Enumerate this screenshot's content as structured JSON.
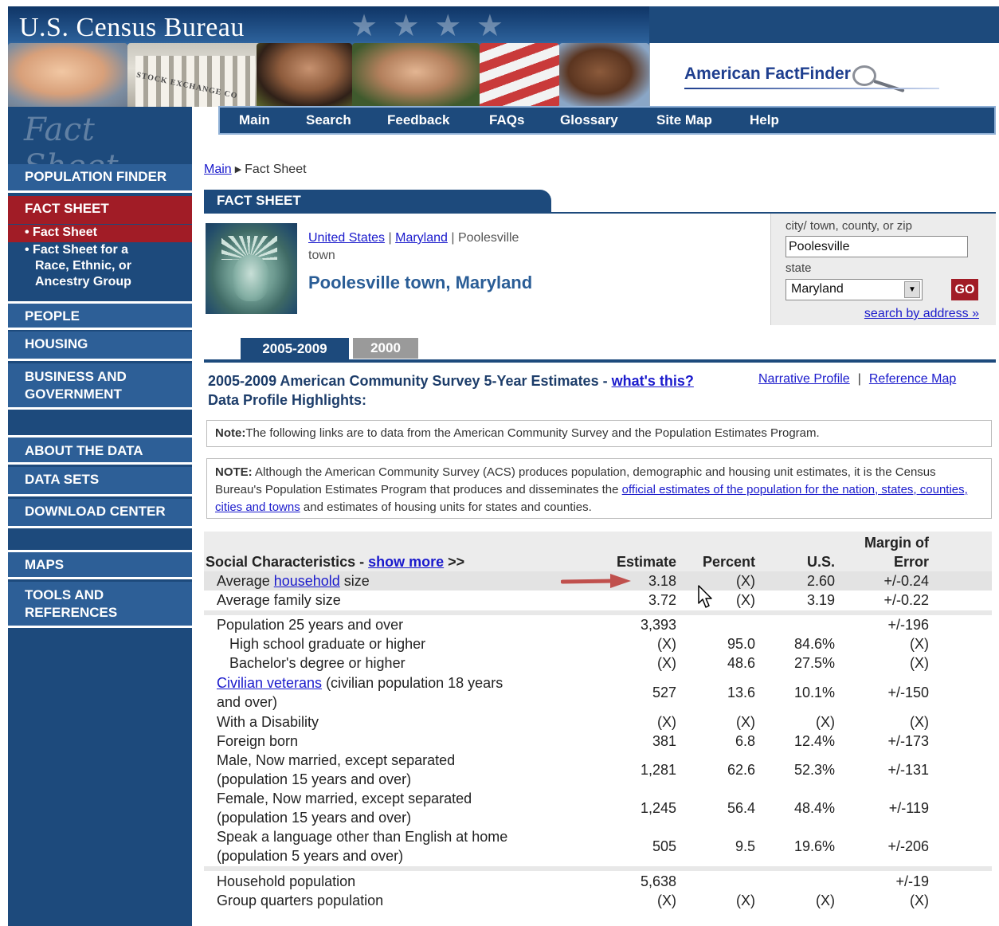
{
  "header": {
    "bureau_title": "U.S. Census Bureau",
    "stock_exchange_text": "STOCK EXCHANGE CO",
    "factfinder_logo": "American FactFinder",
    "fact_sheet_script": "Fact Sheet"
  },
  "nav": {
    "items": [
      "Main",
      "Search",
      "Feedback",
      "FAQs",
      "Glossary",
      "Site Map",
      "Help"
    ]
  },
  "sidebar": {
    "population_finder": "POPULATION FINDER",
    "fact_sheet": "FACT SHEET",
    "sub_fact_sheet": "• Fact Sheet",
    "sub_race_1": "• Fact Sheet for a",
    "sub_race_2": "Race, Ethnic, or",
    "sub_race_3": "Ancestry Group",
    "people": "PEOPLE",
    "housing": "HOUSING",
    "business_1": "BUSINESS AND",
    "business_2": "GOVERNMENT",
    "about": "ABOUT THE DATA",
    "data_sets": "DATA SETS",
    "download": "DOWNLOAD CENTER",
    "maps": "MAPS",
    "tools_1": "TOOLS AND",
    "tools_2": "REFERENCES"
  },
  "breadcrumb": {
    "main": "Main",
    "current": "Fact Sheet"
  },
  "fact_sheet_header": "FACT SHEET",
  "geo": {
    "us_link": "United States",
    "state_link": "Maryland",
    "sep": " | ",
    "place_line1": "Poolesville",
    "place_line2": "town",
    "title": "Poolesville town, Maryland"
  },
  "search": {
    "city_label": "city/ town, county, or zip",
    "city_value": "Poolesville",
    "state_label": "state",
    "state_value": "Maryland",
    "go_label": "GO",
    "address_link": "search by address »"
  },
  "year_tabs": {
    "active": "2005-2009",
    "inactive": "2000"
  },
  "survey": {
    "heading": "2005-2009 American Community Survey 5-Year Estimates - ",
    "whats_this": "what's this?",
    "subheading": "Data Profile Highlights:",
    "narrative_link": "Narrative Profile",
    "link_sep": "|",
    "reference_link": "Reference Map"
  },
  "notes": {
    "note1_bold": "Note:",
    "note1_text": "The following links are to data from the American Community Survey and the Population Estimates Program.",
    "note2_bold": "NOTE:",
    "note2_text_a": " Although the American Community Survey (ACS) produces population, demographic and housing unit estimates, it is the Census Bureau's Population Estimates Program that produces and disseminates the ",
    "note2_link": "official estimates of the population for the nation, states, counties, cities and towns",
    "note2_text_b": " and estimates of housing units for states and counties."
  },
  "table": {
    "section_title": "Social Characteristics - ",
    "show_more": "show more",
    "show_more_suffix": " >>",
    "headers": {
      "estimate": "Estimate",
      "percent": "Percent",
      "us": "U.S.",
      "moe_1": "Margin of",
      "moe_2": "Error"
    },
    "rows": [
      {
        "label_a": "Average ",
        "label_link": "household",
        "label_b": " size",
        "estimate": "3.18",
        "percent": "(X)",
        "us": "2.60",
        "moe": "+/-0.24"
      },
      {
        "label": "Average family size",
        "estimate": "3.72",
        "percent": "(X)",
        "us": "3.19",
        "moe": "+/-0.22"
      },
      {
        "label": "Population 25 years and over",
        "estimate": "3,393",
        "percent": "",
        "us": "",
        "moe": "+/-196"
      },
      {
        "label": "High school graduate or higher",
        "estimate": "(X)",
        "percent": "95.0",
        "us": "84.6%",
        "moe": "(X)"
      },
      {
        "label": "Bachelor's degree or higher",
        "estimate": "(X)",
        "percent": "48.6",
        "us": "27.5%",
        "moe": "(X)"
      },
      {
        "label_link": "Civilian veterans",
        "label_b": " (civilian population 18 years",
        "label_c": "and over)",
        "estimate": "527",
        "percent": "13.6",
        "us": "10.1%",
        "moe": "+/-150"
      },
      {
        "label": "With a Disability",
        "estimate": "(X)",
        "percent": "(X)",
        "us": "(X)",
        "moe": "(X)"
      },
      {
        "label": "Foreign born",
        "estimate": "381",
        "percent": "6.8",
        "us": "12.4%",
        "moe": "+/-173"
      },
      {
        "label": "Male, Now married, except separated",
        "label_c": "(population 15 years and over)",
        "estimate": "1,281",
        "percent": "62.6",
        "us": "52.3%",
        "moe": "+/-131"
      },
      {
        "label": "Female, Now married, except separated",
        "label_c": "(population 15 years and over)",
        "estimate": "1,245",
        "percent": "56.4",
        "us": "48.4%",
        "moe": "+/-119"
      },
      {
        "label": "Speak a language other than English at home",
        "label_c": "(population 5 years and over)",
        "estimate": "505",
        "percent": "9.5",
        "us": "19.6%",
        "moe": "+/-206"
      },
      {
        "label": "Household population",
        "estimate": "5,638",
        "percent": "",
        "us": "",
        "moe": "+/-19"
      },
      {
        "label": "Group quarters population",
        "estimate": "(X)",
        "percent": "(X)",
        "us": "(X)",
        "moe": "(X)"
      }
    ]
  },
  "colors": {
    "navy": "#1d4a7c",
    "sidebar_item": "#2d5f97",
    "active_red": "#a11c26",
    "link_blue": "#1a1acc",
    "heading_blue": "#2a5d96"
  }
}
